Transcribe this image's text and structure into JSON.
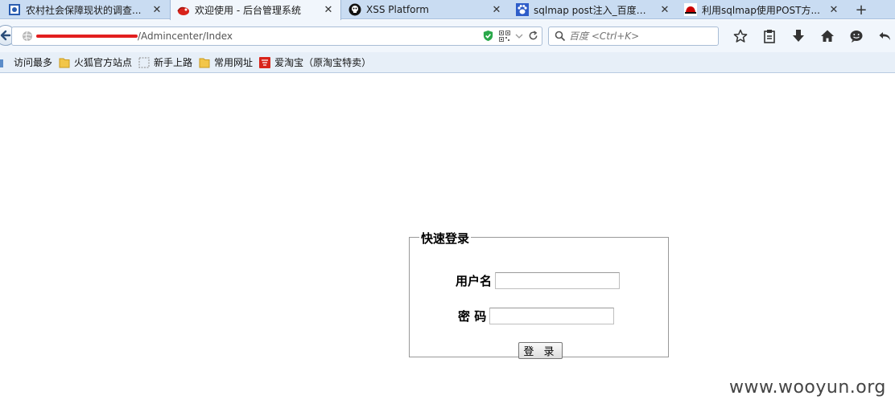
{
  "tabs": [
    {
      "title": "农村社会保障现状的调查...",
      "icon": "document-icon"
    },
    {
      "title": "欢迎使用 - 后台管理系统",
      "icon": "red-bird-icon",
      "active": true
    },
    {
      "title": "XSS Platform",
      "icon": "pirate-skull-icon"
    },
    {
      "title": "sqlmap post注入_百度搜索",
      "icon": "baidu-paw-icon"
    },
    {
      "title": "利用sqlmap使用POST方...",
      "icon": "red-hat-icon"
    }
  ],
  "newtab_label": "+",
  "close_glyph": "✕",
  "address": {
    "url_visible": "/Admincenter/Index",
    "redacted": true
  },
  "search": {
    "placeholder": "百度 <Ctrl+K>"
  },
  "bookmarks": [
    {
      "label": "访问最多",
      "icon": "most-visited-icon"
    },
    {
      "label": "火狐官方站点",
      "icon": "folder-icon"
    },
    {
      "label": "新手上路",
      "icon": "blank-page-icon"
    },
    {
      "label": "常用网址",
      "icon": "folder-icon"
    },
    {
      "label": "爱淘宝（原淘宝特卖）",
      "icon": "taobao-icon"
    }
  ],
  "login": {
    "legend": "快速登录",
    "username_label": "用户名",
    "password_label": "密 码",
    "submit_label": "登 录"
  },
  "watermark": "www.wooyun.org"
}
